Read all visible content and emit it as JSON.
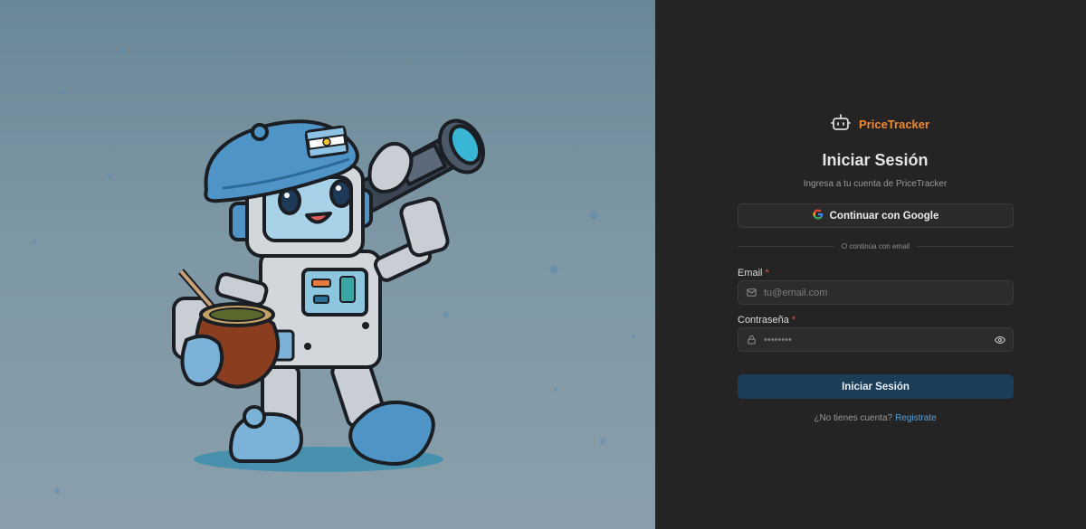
{
  "brand": {
    "name": "PriceTracker",
    "accent": "#f0892e"
  },
  "login": {
    "title": "Iniciar Sesión",
    "subtitle": "Ingresa a tu cuenta de PriceTracker",
    "google_button": "Continuar con Google",
    "divider_text": "O continúa con email",
    "email": {
      "label": "Email",
      "required_mark": "*",
      "placeholder": "tu@email.com",
      "value": ""
    },
    "password": {
      "label": "Contraseña",
      "required_mark": "*",
      "placeholder": "••••••••",
      "value": ""
    },
    "submit_button": "Iniciar Sesión",
    "register_prompt": "¿No tienes cuenta?",
    "register_link": "Registrate"
  },
  "icons": {
    "brand": "robot-icon",
    "google": "google-icon",
    "email": "mail-icon",
    "password": "lock-icon",
    "toggle_password": "eye-icon"
  },
  "colors": {
    "panel_bg": "#242424",
    "primary_button": "#1b3d57",
    "link": "#5aa0d8",
    "required": "#e05252"
  }
}
